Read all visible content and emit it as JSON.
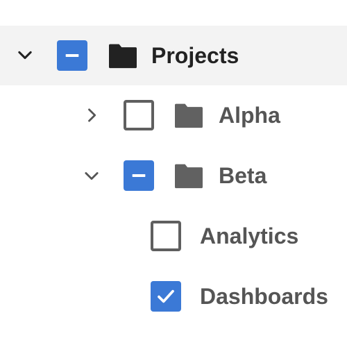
{
  "tree": {
    "root": {
      "label": "Projects",
      "expanded": true,
      "check_state": "indeterminate",
      "icon": "folder-icon",
      "children": [
        {
          "label": "Alpha",
          "expanded": false,
          "check_state": "unchecked",
          "icon": "folder-icon"
        },
        {
          "label": "Beta",
          "expanded": true,
          "check_state": "indeterminate",
          "icon": "folder-icon",
          "children": [
            {
              "label": "Analytics",
              "check_state": "unchecked"
            },
            {
              "label": "Dashboards",
              "check_state": "checked"
            }
          ]
        }
      ]
    }
  },
  "colors": {
    "checkbox_fill": "#3b79d6",
    "checkbox_border": "#5f5f5f",
    "selected_row_bg": "#f3f3f3",
    "root_folder": "#222222",
    "child_folder": "#616161"
  }
}
